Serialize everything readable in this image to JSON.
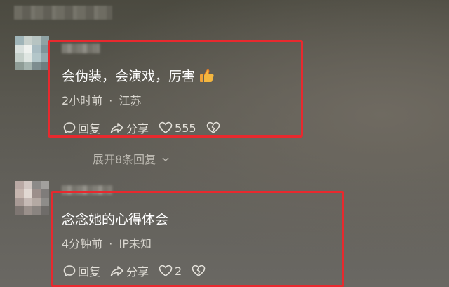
{
  "comments": [
    {
      "text": "会伪装，会演戏，厉害",
      "emoji": "thumbs-up-icon",
      "time": "2小时前",
      "separator": "·",
      "location": "江苏",
      "actions": {
        "reply": "回复",
        "share": "分享",
        "likes": "555"
      }
    },
    {
      "text": "念念她的心得体会",
      "time": "4分钟前",
      "separator": "·",
      "location": "IP未知",
      "actions": {
        "reply": "回复",
        "share": "分享",
        "likes": "2"
      }
    }
  ],
  "expand_replies": "展开8条回复",
  "colors": {
    "highlight_box": "#e8292e",
    "text": "#ffffff",
    "meta": "#d9d6cf"
  }
}
